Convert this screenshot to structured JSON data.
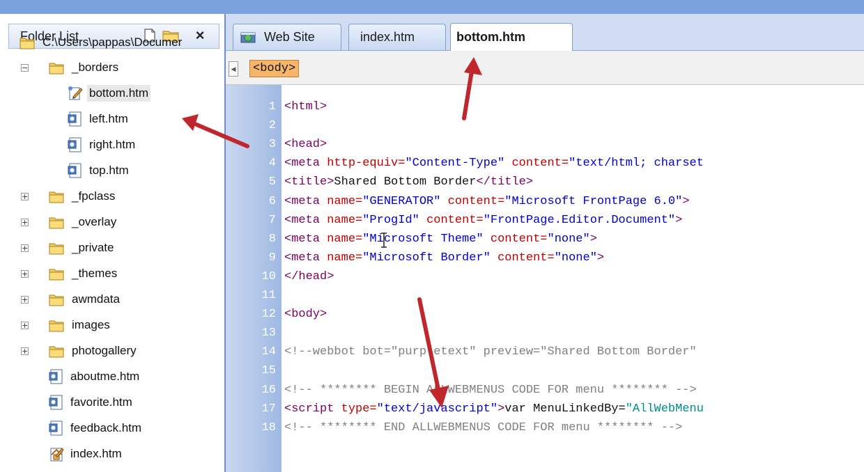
{
  "folder_panel": {
    "title": "Folder List",
    "close_glyph": "×",
    "root_path": "C:\\Users\\pappas\\Documer",
    "items": [
      {
        "label": "_borders",
        "type": "folder",
        "expander": "−"
      },
      {
        "label": "bottom.htm",
        "type": "page-edit"
      },
      {
        "label": "left.htm",
        "type": "page"
      },
      {
        "label": "right.htm",
        "type": "page"
      },
      {
        "label": "top.htm",
        "type": "page"
      },
      {
        "label": "_fpclass",
        "type": "folder",
        "expander": "+"
      },
      {
        "label": "_overlay",
        "type": "folder",
        "expander": "+"
      },
      {
        "label": "_private",
        "type": "folder",
        "expander": "+"
      },
      {
        "label": "_themes",
        "type": "folder",
        "expander": "+"
      },
      {
        "label": "awmdata",
        "type": "folder",
        "expander": "+"
      },
      {
        "label": "images",
        "type": "folder",
        "expander": "+"
      },
      {
        "label": "photogallery",
        "type": "folder",
        "expander": "+"
      },
      {
        "label": "aboutme.htm",
        "type": "page"
      },
      {
        "label": "favorite.htm",
        "type": "page"
      },
      {
        "label": "feedback.htm",
        "type": "page"
      },
      {
        "label": "index.htm",
        "type": "page-home"
      }
    ]
  },
  "tabs": [
    {
      "label": "Web Site"
    },
    {
      "label": "index.htm"
    },
    {
      "label": "bottom.htm"
    }
  ],
  "tag_selector": {
    "label": "<body>"
  },
  "code_lines": [
    {
      "n": "1",
      "parts": [
        [
          "tag",
          "<html>"
        ]
      ]
    },
    {
      "n": "2",
      "parts": []
    },
    {
      "n": "3",
      "parts": [
        [
          "tag",
          "<head>"
        ]
      ]
    },
    {
      "n": "4",
      "parts": [
        [
          "tag",
          "<meta "
        ],
        [
          "attr",
          "http-equiv="
        ],
        [
          "val",
          "\"Content-Type\" "
        ],
        [
          "attr",
          "content="
        ],
        [
          "val",
          "\"text/html; charset"
        ]
      ]
    },
    {
      "n": "5",
      "parts": [
        [
          "tag",
          "<title>"
        ],
        [
          "txt",
          "Shared Bottom Border"
        ],
        [
          "tag",
          "</title>"
        ]
      ]
    },
    {
      "n": "6",
      "parts": [
        [
          "tag",
          "<meta "
        ],
        [
          "attr",
          "name="
        ],
        [
          "val",
          "\"GENERATOR\" "
        ],
        [
          "attr",
          "content="
        ],
        [
          "val",
          "\"Microsoft FrontPage 6.0\""
        ],
        [
          "tag",
          ">"
        ]
      ]
    },
    {
      "n": "7",
      "parts": [
        [
          "tag",
          "<meta "
        ],
        [
          "attr",
          "name="
        ],
        [
          "val",
          "\"ProgId\" "
        ],
        [
          "attr",
          "content="
        ],
        [
          "val",
          "\"FrontPage.Editor.Document\""
        ],
        [
          "tag",
          ">"
        ]
      ]
    },
    {
      "n": "8",
      "parts": [
        [
          "tag",
          "<meta "
        ],
        [
          "attr",
          "name="
        ],
        [
          "val",
          "\"Microsoft Theme\" "
        ],
        [
          "attr",
          "content="
        ],
        [
          "val",
          "\"none\""
        ],
        [
          "tag",
          ">"
        ]
      ]
    },
    {
      "n": "9",
      "parts": [
        [
          "tag",
          "<meta "
        ],
        [
          "attr",
          "name="
        ],
        [
          "val",
          "\"Microsoft Border\" "
        ],
        [
          "attr",
          "content="
        ],
        [
          "val",
          "\"none\""
        ],
        [
          "tag",
          ">"
        ]
      ]
    },
    {
      "n": "10",
      "parts": [
        [
          "tag",
          "</head>"
        ]
      ]
    },
    {
      "n": "11",
      "parts": []
    },
    {
      "n": "12",
      "parts": [
        [
          "tag",
          "<body>"
        ]
      ]
    },
    {
      "n": "13",
      "parts": []
    },
    {
      "n": "14",
      "parts": [
        [
          "cmt",
          "<!--webbot bot=\"purpletext\" preview=\"Shared Bottom Border\""
        ]
      ]
    },
    {
      "n": "15",
      "parts": []
    },
    {
      "n": "16",
      "parts": [
        [
          "cmt",
          "<!-- ******** BEGIN ALLWEBMENUS CODE FOR menu ******** -->"
        ]
      ]
    },
    {
      "n": "17",
      "parts": [
        [
          "tag",
          "<script "
        ],
        [
          "attr",
          "type="
        ],
        [
          "val",
          "\"text/javascript\""
        ],
        [
          "tag",
          ">"
        ],
        [
          "txt",
          "var MenuLinkedBy="
        ],
        [
          "teal",
          "\"AllWebMenu"
        ]
      ]
    },
    {
      "n": "18",
      "parts": [
        [
          "cmt",
          "<!-- ******** END ALLWEBMENUS CODE FOR menu ******** -->"
        ]
      ]
    }
  ],
  "colors": {
    "accent": "#cfdcf1",
    "gutter": "#9fb9e3",
    "arrow": "#c0272d",
    "tag_highlight": "#f7b56a"
  }
}
